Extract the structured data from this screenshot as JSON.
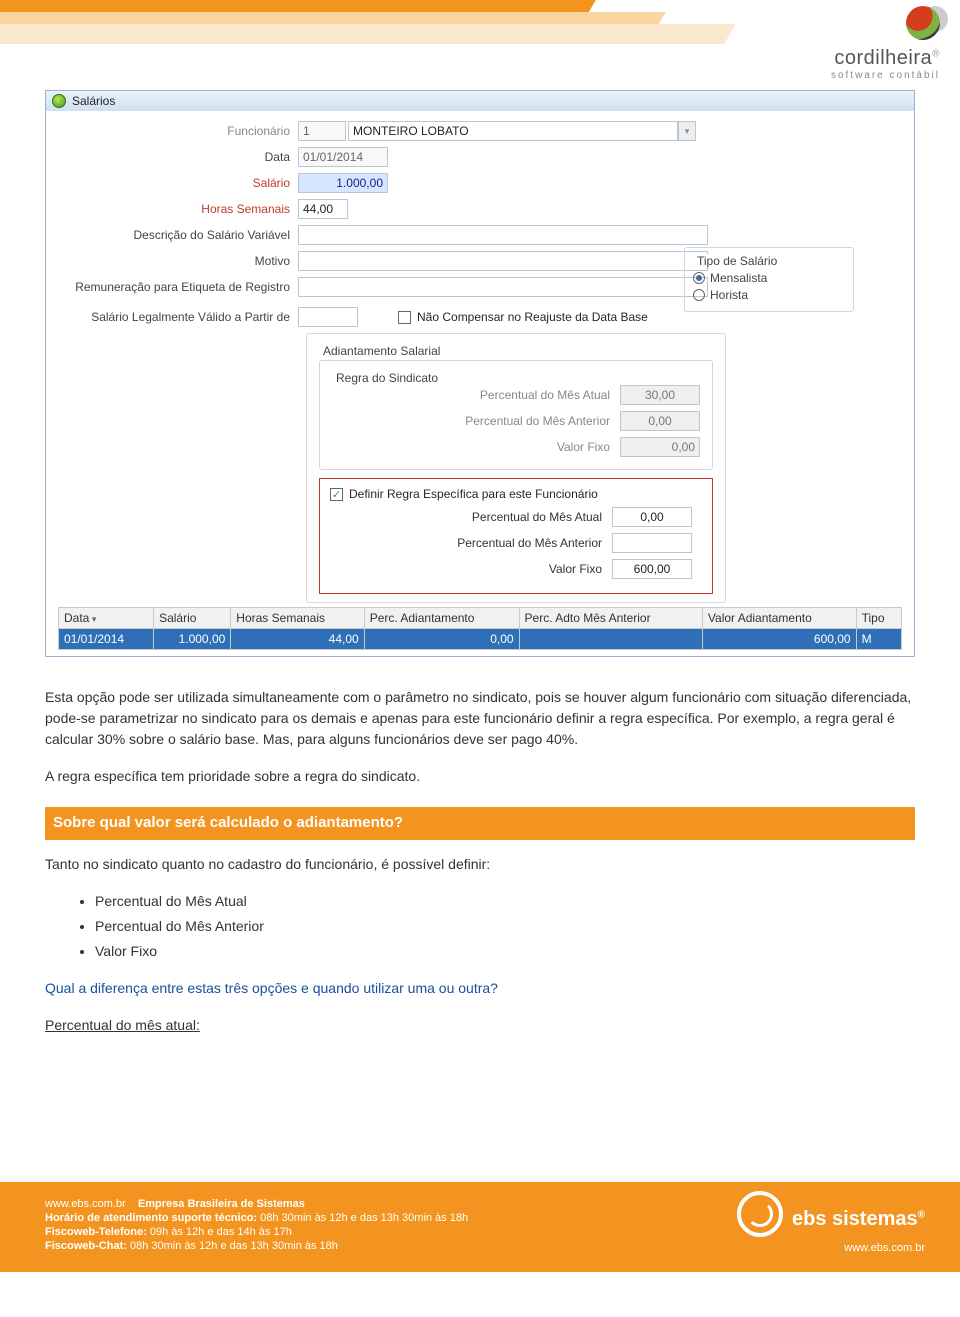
{
  "logo": {
    "name": "cordilheira",
    "sub": "software contábil"
  },
  "win": {
    "title": "Salários",
    "labels": {
      "funcionario": "Funcionário",
      "data": "Data",
      "salario": "Salário",
      "horas": "Horas Semanais",
      "desc_var": "Descrição do Salário Variável",
      "motivo": "Motivo",
      "remun_reg": "Remuneração para Etiqueta de Registro",
      "sal_legal": "Salário Legalmente Válido a Partir de",
      "nao_compensar": "Não Compensar no Reajuste da Data Base",
      "tipo_salario": "Tipo de Salário",
      "mensalista": "Mensalista",
      "horista": "Horista"
    },
    "values": {
      "func_code": "1",
      "func_name": "MONTEIRO LOBATO",
      "data": "01/01/2014",
      "salario": "1.000,00",
      "horas": "44,00"
    },
    "adian": {
      "fieldset": "Adiantamento Salarial",
      "sub": "Regra do Sindicato",
      "pma": "Percentual do Mês Atual",
      "pmant": "Percentual do Mês Anterior",
      "vfixo": "Valor Fixo",
      "v_pma": "30,00",
      "v_pmant": "0,00",
      "v_vfixo": "0,00",
      "spec_chk": "Definir Regra Específica para este Funcionário",
      "spec_pma": "0,00",
      "spec_pmant": "",
      "spec_vfixo": "600,00"
    },
    "table": {
      "headers": [
        "Data",
        "Salário",
        "Horas Semanais",
        "Perc. Adiantamento",
        "Perc. Adto Mês Anterior",
        "Valor Adiantamento",
        "Tipo"
      ],
      "row": [
        "01/01/2014",
        "1.000,00",
        "44,00",
        "0,00",
        "",
        "600,00",
        "M"
      ]
    }
  },
  "body": {
    "p1": "Esta opção pode ser utilizada simultaneamente com o parâmetro no sindicato, pois se houver algum funcionário com situação diferenciada, pode-se parametrizar no sindicato para os demais e apenas para este funcionário definir a regra específica. Por exemplo, a regra geral é calcular 30% sobre o salário base. Mas, para alguns funcionários deve ser pago 40%.",
    "p2": "A regra específica tem prioridade sobre a regra do sindicato.",
    "heading": "Sobre qual valor será calculado o adiantamento?",
    "p3": "Tanto no sindicato quanto no cadastro do funcionário, é possível definir:",
    "bullets": [
      "Percentual do Mês Atual",
      "Percentual do Mês Anterior",
      "Valor Fixo"
    ],
    "q": "Qual a diferença entre estas três opções e quando utilizar uma ou outra?",
    "und": "Percentual do mês atual:"
  },
  "footer": {
    "url": "www.ebs.com.br",
    "company": "Empresa Brasileira de Sistemas",
    "l1a": "Horário de atendimento suporte técnico:",
    "l1b": "08h 30min às 12h e das 13h 30min às 18h",
    "l2a": "Fiscoweb-Telefone:",
    "l2b": "09h às 12h e das 14h às 17h",
    "l3a": "Fiscoweb-Chat:",
    "l3b": "08h 30min às 12h e das 13h 30min às 18h",
    "brand": "ebs sistemas",
    "brand_url": "www.ebs.com.br"
  }
}
